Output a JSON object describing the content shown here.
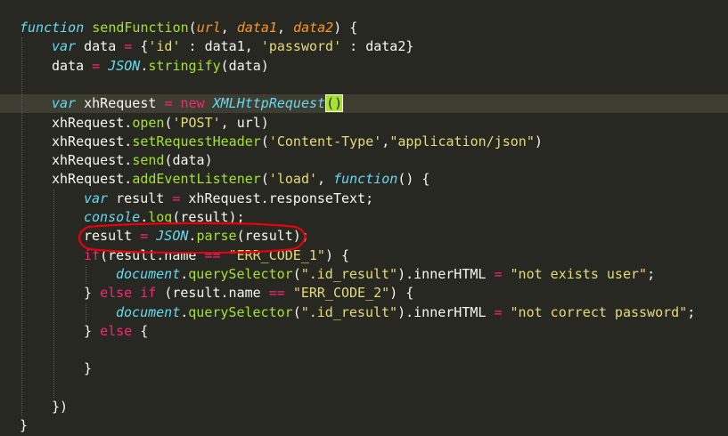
{
  "editor": {
    "lines": [
      [
        [
          "kw",
          "function "
        ],
        [
          "fn",
          "sendFunction"
        ],
        [
          "pl",
          "("
        ],
        [
          "param",
          "url"
        ],
        [
          "pl",
          ", "
        ],
        [
          "param",
          "data1"
        ],
        [
          "pl",
          ", "
        ],
        [
          "param",
          "data2"
        ],
        [
          "pl",
          ") {"
        ]
      ],
      [
        [
          "kw",
          "var "
        ],
        [
          "pl",
          "data "
        ],
        [
          "op",
          "= "
        ],
        [
          "pl",
          "{"
        ],
        [
          "str",
          "'id'"
        ],
        [
          "pl",
          " : data1, "
        ],
        [
          "str",
          "'password'"
        ],
        [
          "pl",
          " : data2}"
        ]
      ],
      [
        [
          "pl",
          "data "
        ],
        [
          "op",
          "= "
        ],
        [
          "cls",
          "JSON"
        ],
        [
          "pl",
          "."
        ],
        [
          "fn",
          "stringify"
        ],
        [
          "pl",
          "(data)"
        ]
      ],
      [],
      [
        [
          "kw",
          "var "
        ],
        [
          "pl",
          "xhRequest "
        ],
        [
          "op",
          "= "
        ],
        [
          "ctl",
          "new "
        ],
        [
          "cls",
          "XMLHttpRequest"
        ],
        [
          "bracket",
          "()"
        ]
      ],
      [
        [
          "pl",
          "xhRequest."
        ],
        [
          "fn",
          "open"
        ],
        [
          "pl",
          "("
        ],
        [
          "str",
          "'POST'"
        ],
        [
          "pl",
          ", url)"
        ]
      ],
      [
        [
          "pl",
          "xhRequest."
        ],
        [
          "fn",
          "setRequestHeader"
        ],
        [
          "pl",
          "("
        ],
        [
          "str",
          "'Content-Type'"
        ],
        [
          "pl",
          ","
        ],
        [
          "str",
          "\"application/json\""
        ],
        [
          "pl",
          ")"
        ]
      ],
      [
        [
          "pl",
          "xhRequest."
        ],
        [
          "fn",
          "send"
        ],
        [
          "pl",
          "(data)"
        ]
      ],
      [
        [
          "pl",
          "xhRequest."
        ],
        [
          "fn",
          "addEventListener"
        ],
        [
          "pl",
          "("
        ],
        [
          "str",
          "'load'"
        ],
        [
          "pl",
          ", "
        ],
        [
          "kw",
          "function"
        ],
        [
          "pl",
          "() {"
        ]
      ],
      [
        [
          "kw",
          "var "
        ],
        [
          "pl",
          "result "
        ],
        [
          "op",
          "= "
        ],
        [
          "pl",
          "xhRequest.responseText;"
        ]
      ],
      [
        [
          "cls",
          "console"
        ],
        [
          "pl",
          "."
        ],
        [
          "fn",
          "log"
        ],
        [
          "pl",
          "(result);"
        ]
      ],
      [
        [
          "pl",
          "result "
        ],
        [
          "op",
          "= "
        ],
        [
          "cls",
          "JSON"
        ],
        [
          "pl",
          "."
        ],
        [
          "fn",
          "parse"
        ],
        [
          "pl",
          "(result);"
        ]
      ],
      [
        [
          "ctl",
          "if"
        ],
        [
          "pl",
          "(result.name "
        ],
        [
          "op",
          "== "
        ],
        [
          "str",
          "\"ERR_CODE_1\""
        ],
        [
          "pl",
          ") {"
        ]
      ],
      [
        [
          "cls",
          "document"
        ],
        [
          "pl",
          "."
        ],
        [
          "fn",
          "querySelector"
        ],
        [
          "pl",
          "("
        ],
        [
          "str",
          "\".id_result\""
        ],
        [
          "pl",
          ").innerHTML "
        ],
        [
          "op",
          "= "
        ],
        [
          "str",
          "\"not exists user\""
        ],
        [
          "pl",
          ";"
        ]
      ],
      [
        [
          "pl",
          "} "
        ],
        [
          "ctl",
          "else if "
        ],
        [
          "pl",
          "(result.name "
        ],
        [
          "op",
          "== "
        ],
        [
          "str",
          "\"ERR_CODE_2\""
        ],
        [
          "pl",
          ") {"
        ]
      ],
      [
        [
          "cls",
          "document"
        ],
        [
          "pl",
          "."
        ],
        [
          "fn",
          "querySelector"
        ],
        [
          "pl",
          "("
        ],
        [
          "str",
          "\".id_result\""
        ],
        [
          "pl",
          ").innerHTML "
        ],
        [
          "op",
          "= "
        ],
        [
          "str",
          "\"not correct password\""
        ],
        [
          "pl",
          ";"
        ]
      ],
      [
        [
          "pl",
          "} "
        ],
        [
          "ctl",
          "else "
        ],
        [
          "pl",
          "{"
        ]
      ],
      [],
      [
        [
          "pl",
          "}"
        ]
      ],
      [],
      [
        [
          "pl",
          "})"
        ]
      ],
      [
        [
          "pl",
          "}"
        ]
      ]
    ],
    "active_line": 4,
    "annotated_line": 11,
    "colors": {
      "background": "#272822",
      "active_line": "#3e3d32",
      "keyword": "#66d9ef",
      "function": "#a6e22e",
      "string": "#e6db74",
      "operator": "#f92672",
      "parameter": "#fd971f",
      "annotation": "#e8000d"
    }
  }
}
